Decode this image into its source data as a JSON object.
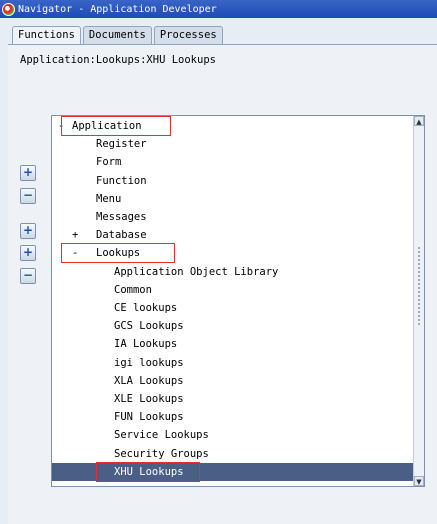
{
  "window": {
    "title": "Navigator - Application Developer"
  },
  "tabs": [
    {
      "label": "Functions",
      "active": true
    },
    {
      "label": "Documents",
      "active": false
    },
    {
      "label": "Processes",
      "active": false
    }
  ],
  "path": "Application:Lookups:XHU Lookups",
  "side_buttons": [
    {
      "icon": "expand-icon",
      "glyph": "+"
    },
    {
      "icon": "collapse-icon",
      "glyph": "−"
    },
    {
      "icon": "expand-branch-icon",
      "glyph": "+"
    },
    {
      "icon": "expand-all-icon",
      "glyph": "+"
    },
    {
      "icon": "collapse-all-icon",
      "glyph": "−"
    }
  ],
  "tree": [
    {
      "toggle": "-",
      "label": "Application",
      "level": 0,
      "highlight": true
    },
    {
      "toggle": "",
      "label": "Register",
      "level": 1
    },
    {
      "toggle": "",
      "label": "Form",
      "level": 1
    },
    {
      "toggle": "",
      "label": "Function",
      "level": 1
    },
    {
      "toggle": "",
      "label": "Menu",
      "level": 1
    },
    {
      "toggle": "",
      "label": "Messages",
      "level": 1
    },
    {
      "toggle": "+",
      "label": "Database",
      "level": 1
    },
    {
      "toggle": "-",
      "label": "Lookups",
      "level": 1,
      "highlight": true
    },
    {
      "toggle": "",
      "label": "Application Object Library",
      "level": 2
    },
    {
      "toggle": "",
      "label": "Common",
      "level": 2
    },
    {
      "toggle": "",
      "label": "CE lookups",
      "level": 2
    },
    {
      "toggle": "",
      "label": "GCS Lookups",
      "level": 2
    },
    {
      "toggle": "",
      "label": "IA Lookups",
      "level": 2
    },
    {
      "toggle": "",
      "label": "igi lookups",
      "level": 2
    },
    {
      "toggle": "",
      "label": "XLA Lookups",
      "level": 2
    },
    {
      "toggle": "",
      "label": "XLE Lookups",
      "level": 2
    },
    {
      "toggle": "",
      "label": "FUN Lookups",
      "level": 2
    },
    {
      "toggle": "",
      "label": "Service Lookups",
      "level": 2
    },
    {
      "toggle": "",
      "label": "Security Groups",
      "level": 2
    },
    {
      "toggle": "",
      "label": "XHU Lookups",
      "level": 2,
      "selected": true,
      "highlight": true
    }
  ],
  "colors": {
    "selected": "#4b5f86",
    "annotation": "#e03030",
    "titlebar": "#1e4bb7"
  }
}
